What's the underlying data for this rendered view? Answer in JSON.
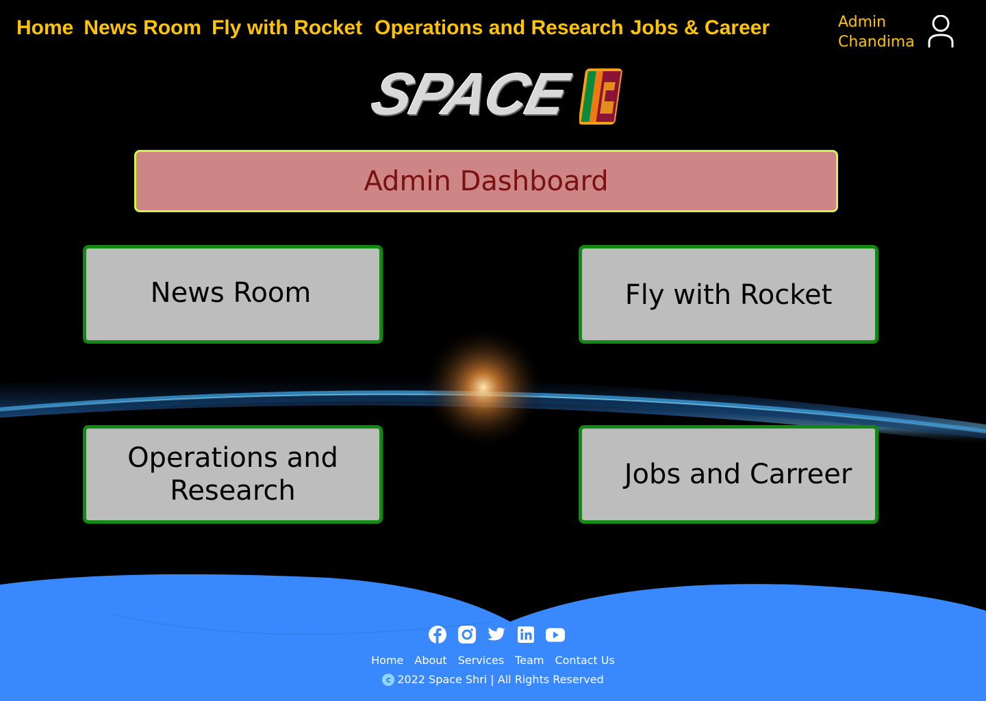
{
  "nav": {
    "items": [
      {
        "label": "Home"
      },
      {
        "label": "News Room"
      },
      {
        "label": "Fly with Rocket"
      },
      {
        "label": "Operations and Research"
      },
      {
        "label": "Jobs & Career"
      }
    ]
  },
  "user": {
    "line1": "Admin",
    "line2": "Chandima",
    "icon": "user-icon"
  },
  "logo": {
    "text": "SPACE"
  },
  "banner": {
    "title": "Admin Dashboard"
  },
  "tiles": [
    {
      "label": "News Room"
    },
    {
      "label": "Fly with Rocket"
    },
    {
      "label": "Operations and Research"
    },
    {
      "label": "Jobs and Carreer"
    }
  ],
  "footer": {
    "socials": [
      "facebook-icon",
      "instagram-icon",
      "twitter-icon",
      "linkedin-icon",
      "youtube-icon"
    ],
    "links": [
      {
        "label": "Home"
      },
      {
        "label": "About"
      },
      {
        "label": "Services"
      },
      {
        "label": "Team"
      },
      {
        "label": "Contact Us"
      }
    ],
    "copyright": "2022 Space Shri | All Rights Reserved"
  },
  "colors": {
    "nav_text": "#FFC400",
    "banner_bg": "#CD8585",
    "banner_border": "#D6F24C",
    "banner_text": "#7A1111",
    "tile_bg": "#BDBDBD",
    "tile_border": "#108A10",
    "footer_bg": "#3A88FE"
  }
}
